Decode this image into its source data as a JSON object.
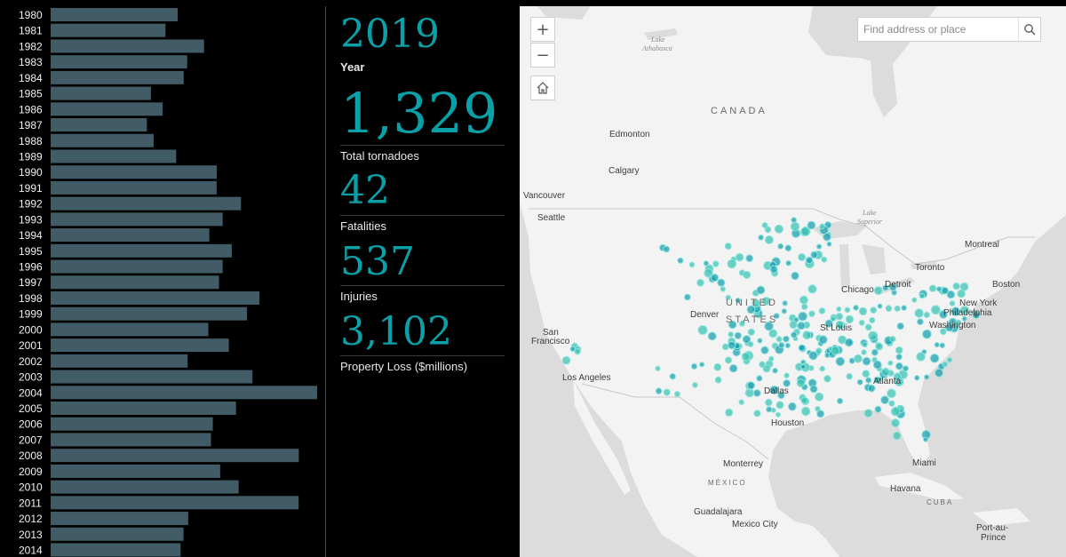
{
  "chart_data": {
    "type": "bar",
    "orientation": "horizontal",
    "categories": [
      "1980",
      "1981",
      "1982",
      "1983",
      "1984",
      "1985",
      "1986",
      "1987",
      "1988",
      "1989",
      "1990",
      "1991",
      "1992",
      "1993",
      "1994",
      "1995",
      "1996",
      "1997",
      "1998",
      "1999",
      "2000",
      "2001",
      "2002",
      "2003",
      "2004",
      "2005",
      "2006",
      "2007",
      "2008",
      "2009",
      "2010",
      "2011",
      "2012",
      "2013",
      "2014"
    ],
    "values": [
      866,
      783,
      1046,
      931,
      907,
      684,
      764,
      656,
      702,
      856,
      1133,
      1132,
      1298,
      1173,
      1082,
      1235,
      1173,
      1148,
      1424,
      1339,
      1075,
      1215,
      934,
      1376,
      1817,
      1264,
      1106,
      1093,
      1692,
      1156,
      1282,
      1691,
      938,
      906,
      886
    ],
    "xlim": [
      0,
      1817
    ],
    "bar_color": "#415c66"
  },
  "stats": {
    "year_value": "2019",
    "year_label": "Year",
    "tornadoes_value": "1,329",
    "tornadoes_label": "Total tornadoes",
    "fatalities_value": "42",
    "fatalities_label": "Fatalities",
    "injuries_value": "537",
    "injuries_label": "Injuries",
    "loss_value": "3,102",
    "loss_label": "Property Loss ($millions)",
    "accent_color": "#0aa0a8"
  },
  "map": {
    "zoom_in_label": "+",
    "zoom_out_label": "−",
    "home_icon": "home-icon",
    "search_placeholder": "Find address or place",
    "search_icon": "search-icon",
    "marker_color": "#1b9fb0",
    "labels": {
      "canada": "CANADA",
      "united": "UNITED",
      "states": "STATES",
      "mexico": "MÉXICO",
      "cuba": "CUBA",
      "lake_athabasca_1": "Lake",
      "lake_athabasca_2": "Athabasca",
      "lake_superior_1": "Lake",
      "lake_superior_2": "Superior",
      "edmonton": "Edmonton",
      "calgary": "Calgary",
      "vancouver": "Vancouver",
      "seattle": "Seattle",
      "montreal": "Montreal",
      "toronto": "Toronto",
      "boston": "Boston",
      "detroit": "Detroit",
      "chicago": "Chicago",
      "new_york": "New York",
      "philadelphia": "Philadelphia",
      "washington": "Washington",
      "denver": "Denver",
      "san": "San",
      "francisco": "Francisco",
      "st_louis": "St Louis",
      "los_angeles": "Los Angeles",
      "atlanta": "Atlanta",
      "dallas": "Dallas",
      "houston": "Houston",
      "miami": "Miami",
      "monterrey": "Monterrey",
      "havana": "Havana",
      "guadalajara": "Guadalajara",
      "mexico_city": "Mexico City",
      "port_au": "Port-au-",
      "prince": "Prince"
    }
  }
}
